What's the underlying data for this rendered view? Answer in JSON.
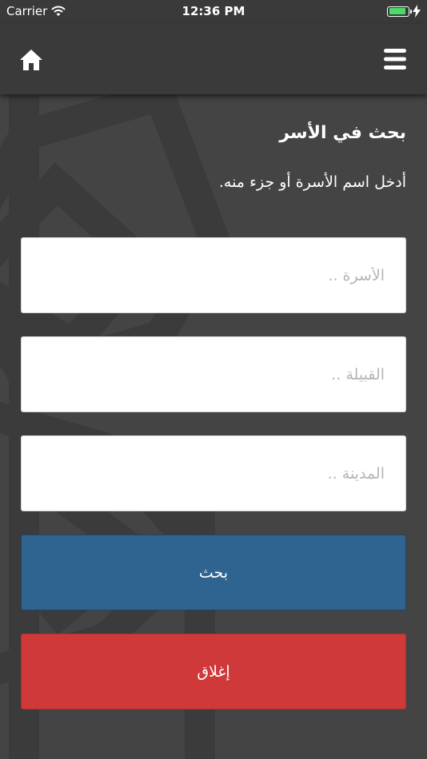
{
  "status_bar": {
    "carrier": "Carrier",
    "time": "12:36 PM",
    "battery_level": 0.9,
    "wifi_icon": "wifi-icon",
    "battery_icon": "battery-icon",
    "charging_icon": "bolt-icon"
  },
  "nav_bar": {
    "home_icon": "home-icon",
    "menu_icon": "hamburger-menu-icon"
  },
  "page": {
    "title": "بحث في الأسر",
    "instruction": "أدخل اسم الأسرة أو جزء منه."
  },
  "form": {
    "family": {
      "placeholder": "الأسرة ..",
      "value": ""
    },
    "tribe": {
      "placeholder": "القبيلة ..",
      "value": ""
    },
    "city": {
      "placeholder": "المدينة ..",
      "value": ""
    },
    "search_label": "بحث",
    "close_label": "إغلاق"
  },
  "colors": {
    "background": "#444444",
    "bars": "#3a3a3a",
    "search_button": "#2f6491",
    "close_button": "#d0393a",
    "battery": "#4cd964"
  }
}
